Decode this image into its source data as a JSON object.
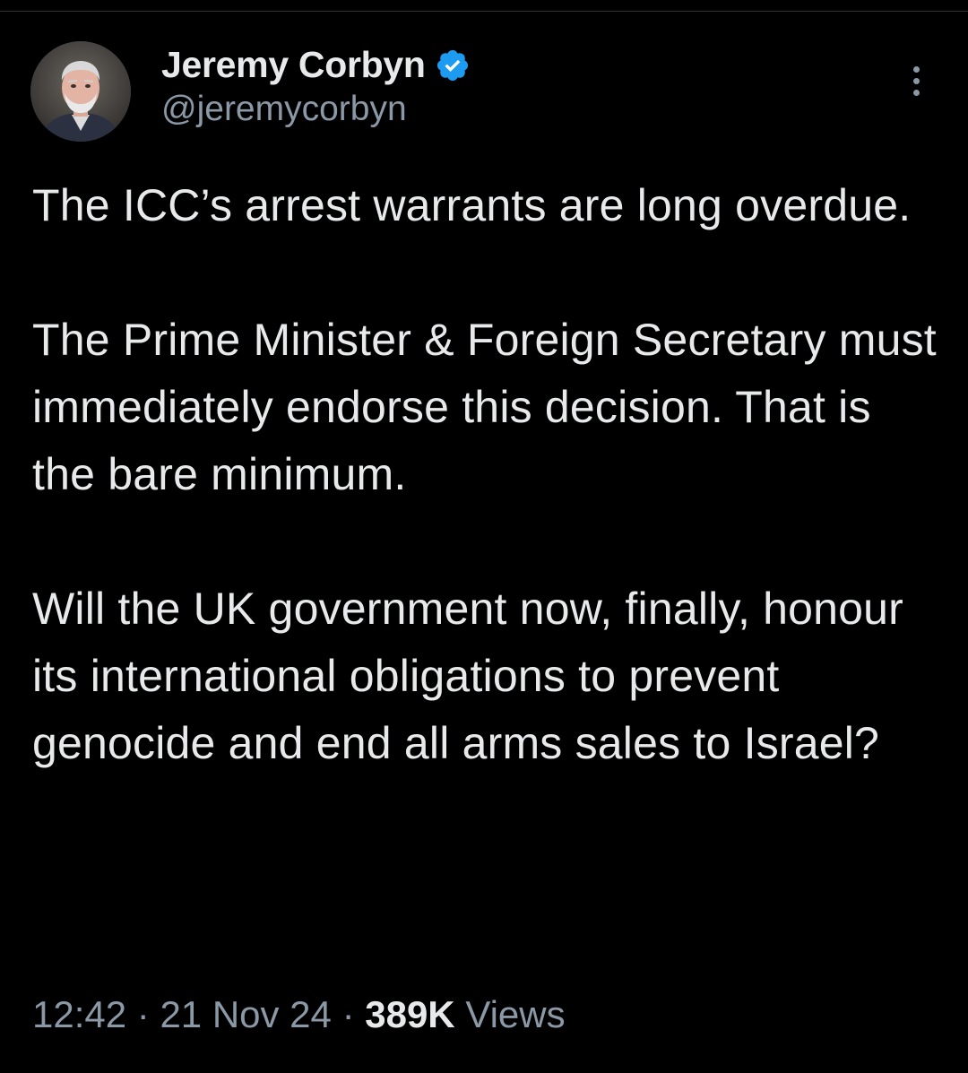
{
  "author": {
    "display_name": "Jeremy Corbyn",
    "handle": "@jeremycorbyn",
    "avatar_icon": "profile-photo-icon",
    "verified_icon": "verified-badge-icon",
    "verified_color": "#1d9bf0"
  },
  "more_icon": "more-options-icon",
  "tweet": {
    "paragraphs": [
      "The ICC’s arrest warrants are long overdue.",
      "The Prime Minister & Foreign Secretary must immediately endorse this decision. That is the bare minimum.",
      "Will the UK government now, finally, honour its international obligations to prevent genocide and end all arms sales to Israel?"
    ]
  },
  "meta": {
    "time": "12:42",
    "separator": " · ",
    "date": "21 Nov 24",
    "views_count": "389K",
    "views_label": "Views"
  },
  "colors": {
    "background": "#000000",
    "primary_text": "#e7e9ea",
    "secondary_text": "#8b98a5",
    "accent": "#1d9bf0"
  }
}
